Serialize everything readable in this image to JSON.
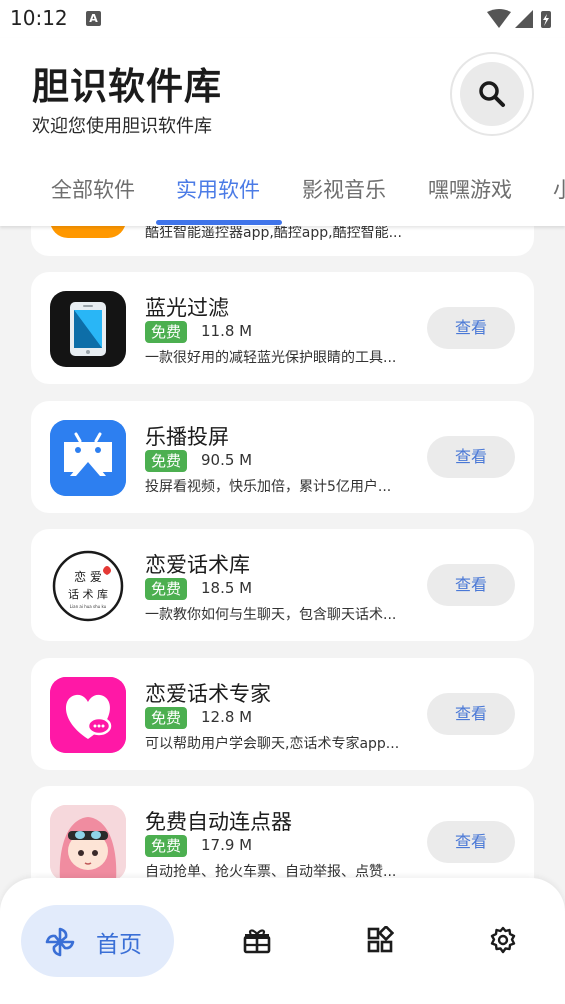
{
  "status_bar": {
    "time": "10:12",
    "a_badge": "A"
  },
  "header": {
    "title": "胆识软件库",
    "subtitle": "欢迎您使用胆识软件库",
    "search_icon": "search-icon"
  },
  "tabs": [
    {
      "label": "全部软件"
    },
    {
      "label": "实用软件"
    },
    {
      "label": "影视音乐"
    },
    {
      "label": "嘿嘿游戏"
    },
    {
      "label": "小"
    }
  ],
  "active_tab": "实用软件",
  "partial_item": {
    "desc": "酷狂智能遥控器app,酷控app,酷控智能..."
  },
  "apps": [
    {
      "name": "蓝光过滤",
      "badge": "免费",
      "size": "11.8 M",
      "desc": "一款很好用的减轻蓝光保护眼睛的工具...",
      "button": "查看"
    },
    {
      "name": "乐播投屏",
      "badge": "免费",
      "size": "90.5 M",
      "desc": "投屏看视频，快乐加倍，累计5亿用户...",
      "button": "查看"
    },
    {
      "name": "恋爱话术库",
      "badge": "免费",
      "size": "18.5 M",
      "desc": "一款教你如何与生聊天，包含聊天话术...",
      "button": "查看"
    },
    {
      "name": "恋爱话术专家",
      "badge": "免费",
      "size": "12.8 M",
      "desc": "可以帮助用户学会聊天,恋话术专家app...",
      "button": "查看"
    },
    {
      "name": "免费自动连点器",
      "badge": "免费",
      "size": "17.9 M",
      "desc": "自动抢单、抢火车票、自动举报、点赞...",
      "button": "查看"
    }
  ],
  "icon_text": {
    "love_logo_line1": "恋 爱",
    "love_logo_line2": "话 术 库",
    "love_logo_line3": "Lian ai hua shu ku"
  },
  "bottom_nav": {
    "home_label": "首页",
    "items": [
      "pinwheel-icon",
      "gift-icon",
      "apps-icon",
      "settings-icon"
    ]
  },
  "colors": {
    "accent": "#4b7be6",
    "free_badge": "#4caf50",
    "nav_active_bg": "#e2ebfb",
    "partial_icon": "#ff9800"
  }
}
